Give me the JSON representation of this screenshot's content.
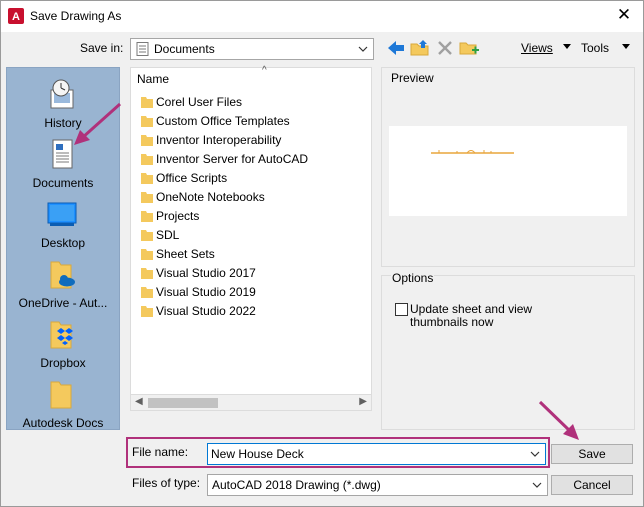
{
  "dialog": {
    "title": "Save Drawing As",
    "close_glyph": "✕"
  },
  "save_in": {
    "label": "Save in:",
    "value": "Documents",
    "toolbar_icons": [
      "back-arrow-icon",
      "up-folder-icon",
      "delete-icon",
      "new-folder-icon"
    ],
    "views_label": "Views",
    "tools_label": "Tools"
  },
  "places": [
    {
      "label": "History",
      "icon": "history-icon"
    },
    {
      "label": "Documents",
      "icon": "documents-icon"
    },
    {
      "label": "Desktop",
      "icon": "desktop-icon"
    },
    {
      "label": "OneDrive - Aut...",
      "icon": "onedrive-folder-icon"
    },
    {
      "label": "Dropbox",
      "icon": "dropbox-folder-icon"
    },
    {
      "label": "Autodesk Docs",
      "icon": "folder-icon"
    }
  ],
  "file_list": {
    "column_name": "Name",
    "items": [
      "Corel User Files",
      "Custom Office Templates",
      "Inventor Interoperability",
      "Inventor Server for AutoCAD",
      "Office Scripts",
      "OneNote Notebooks",
      "Projects",
      "SDL",
      "Sheet Sets",
      "Visual Studio 2017",
      "Visual Studio 2019",
      "Visual Studio 2022"
    ]
  },
  "preview": {
    "label": "Preview"
  },
  "options": {
    "label": "Options",
    "thumbnail_checkbox_label": "Update sheet and view thumbnails now",
    "thumbnail_checked": false
  },
  "file_name": {
    "label": "File name:",
    "value": "New House Deck"
  },
  "file_type": {
    "label": "Files of type:",
    "value": "AutoCAD 2018 Drawing (*.dwg)"
  },
  "buttons": {
    "save": "Save",
    "cancel": "Cancel"
  },
  "colors": {
    "accent": "#0078d4",
    "highlight": "#b0317b",
    "places_bg": "#99b4d1",
    "folder": "#f4c95d",
    "autocad_red": "#c8102e"
  }
}
